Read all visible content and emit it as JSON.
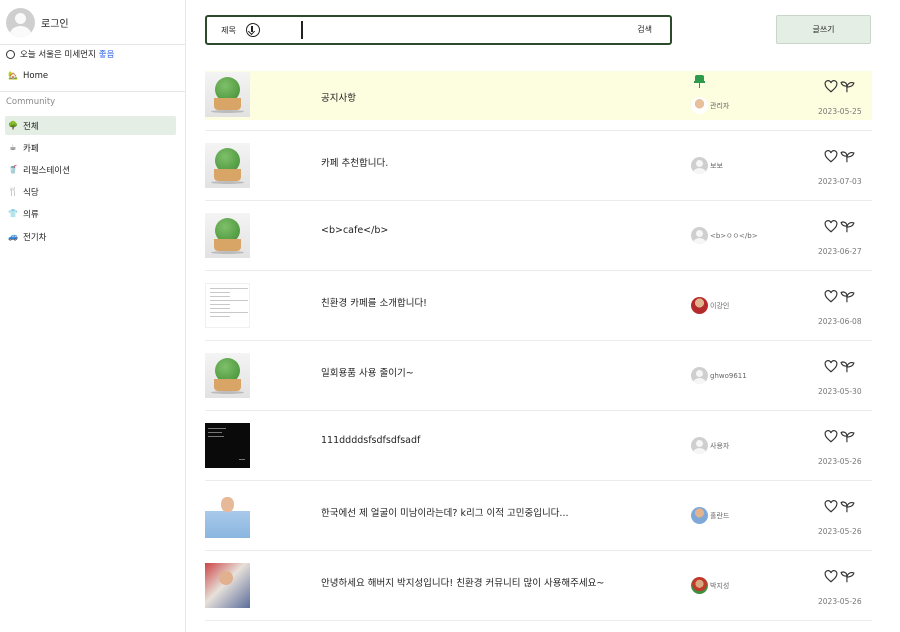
{
  "sidebar": {
    "login_label": "로그인",
    "weather_text": "오늘 서울은 미세먼지",
    "weather_status": "좋음",
    "home_label": "Home",
    "section_label": "Community",
    "items": [
      {
        "label": "전체",
        "icon": "tree-icon",
        "glyph": "🌳",
        "active": true
      },
      {
        "label": "카페",
        "icon": "coffee-icon",
        "glyph": "☕",
        "active": false
      },
      {
        "label": "리필스테이션",
        "icon": "refill-icon",
        "glyph": "🥤",
        "active": false
      },
      {
        "label": "식당",
        "icon": "utensils-icon",
        "glyph": "🍴",
        "active": false
      },
      {
        "label": "의류",
        "icon": "clothing-icon",
        "glyph": "👕",
        "active": false
      },
      {
        "label": "전기차",
        "icon": "car-icon",
        "glyph": "🚙",
        "active": false
      }
    ]
  },
  "search": {
    "field_label": "제목",
    "value": "",
    "button_label": "검색"
  },
  "write_button_label": "글쓰기",
  "posts": [
    {
      "title": "공지사항",
      "author": "관리자",
      "date": "2023-05-25",
      "notice": true,
      "thumb": "tree",
      "avatar": "c-admin"
    },
    {
      "title": "카페 추천합니다.",
      "author": "보보",
      "date": "2023-07-03",
      "notice": false,
      "thumb": "tree",
      "avatar": "gray"
    },
    {
      "title": "<b>cafe</b>",
      "author": "<b>ㅇㅇ</b>",
      "date": "2023-06-27",
      "notice": false,
      "thumb": "tree",
      "avatar": "gray"
    },
    {
      "title": "친환경 카페를 소개합니다!",
      "author": "이강인",
      "date": "2023-06-08",
      "notice": false,
      "thumb": "doc",
      "avatar": "c-red"
    },
    {
      "title": "일회용품 사용 줄이기~",
      "author": "ghwo9611",
      "date": "2023-05-30",
      "notice": false,
      "thumb": "tree",
      "avatar": "gray"
    },
    {
      "title": "111ddddsfsdfsdfsadf",
      "author": "사용자",
      "date": "2023-05-26",
      "notice": false,
      "thumb": "dark",
      "avatar": "gray"
    },
    {
      "title": "한국에선 제 얼굴이 미남이라는데? k리그 이적 고민중입니다...",
      "author": "홀란드",
      "date": "2023-05-26",
      "notice": false,
      "thumb": "jersey",
      "avatar": "c-blue"
    },
    {
      "title": "안녕하세요 해버지 박지성입니다! 친환경 커뮤니티 많이 사용해주세요~",
      "author": "박지성",
      "date": "2023-05-26",
      "notice": false,
      "thumb": "photo",
      "avatar": "c-green"
    }
  ]
}
